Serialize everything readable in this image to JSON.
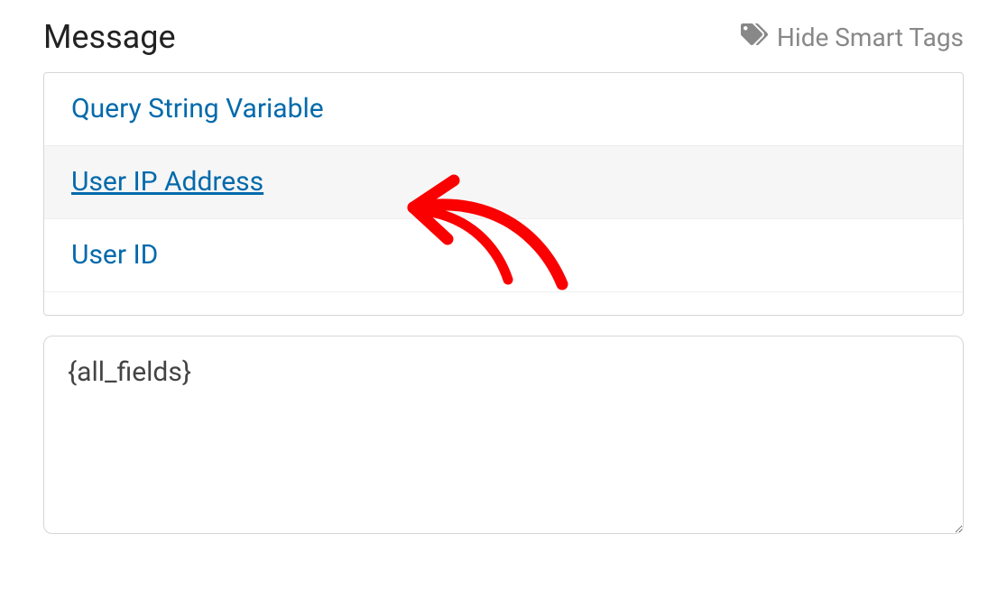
{
  "section": {
    "title": "Message"
  },
  "actions": {
    "hide_smart_tags_label": "Hide Smart Tags"
  },
  "smart_tags": {
    "items": [
      {
        "label": "Query String Variable",
        "hovered": false
      },
      {
        "label": "User IP Address",
        "hovered": true
      },
      {
        "label": "User ID",
        "hovered": false
      },
      {
        "label": "",
        "hovered": false
      }
    ]
  },
  "message_textarea": {
    "value": "{all_fields}"
  }
}
